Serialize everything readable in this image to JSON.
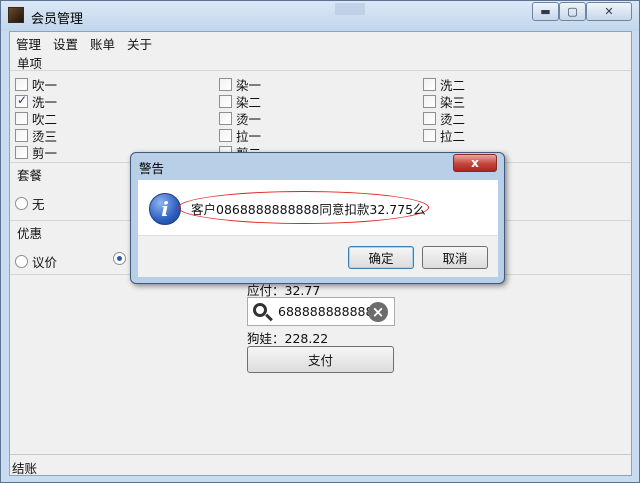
{
  "window": {
    "title": "会员管理"
  },
  "menu": [
    "管理",
    "设置",
    "账单",
    "关于"
  ],
  "single_items": {
    "label": "单项",
    "items": [
      {
        "label": "吹一",
        "checked": false
      },
      {
        "label": "染一",
        "checked": false
      },
      {
        "label": "洗二",
        "checked": false
      },
      {
        "label": "洗一",
        "checked": true
      },
      {
        "label": "染二",
        "checked": false
      },
      {
        "label": "染三",
        "checked": false
      },
      {
        "label": "吹二",
        "checked": false
      },
      {
        "label": "烫一",
        "checked": false
      },
      {
        "label": "烫二",
        "checked": false
      },
      {
        "label": "烫三",
        "checked": false
      },
      {
        "label": "拉一",
        "checked": false
      },
      {
        "label": "拉二",
        "checked": false
      },
      {
        "label": "剪一",
        "checked": false
      },
      {
        "label": "剪二",
        "checked": false
      }
    ]
  },
  "package": {
    "label": "套餐",
    "options": [
      "无"
    ]
  },
  "discount": {
    "label": "优惠",
    "options": [
      "议价",
      ""
    ],
    "selected_index": 1
  },
  "billing": {
    "payable_text": "应付：32.77",
    "search_value": "688888888888",
    "member_text": "狗娃：228.22",
    "pay_label": "支付"
  },
  "status": {
    "text": "结账"
  },
  "dialog": {
    "title": "警告",
    "close": "x",
    "message": "客户0868888888888同意扣款32.775么",
    "ok": "确定",
    "cancel": "取消"
  }
}
